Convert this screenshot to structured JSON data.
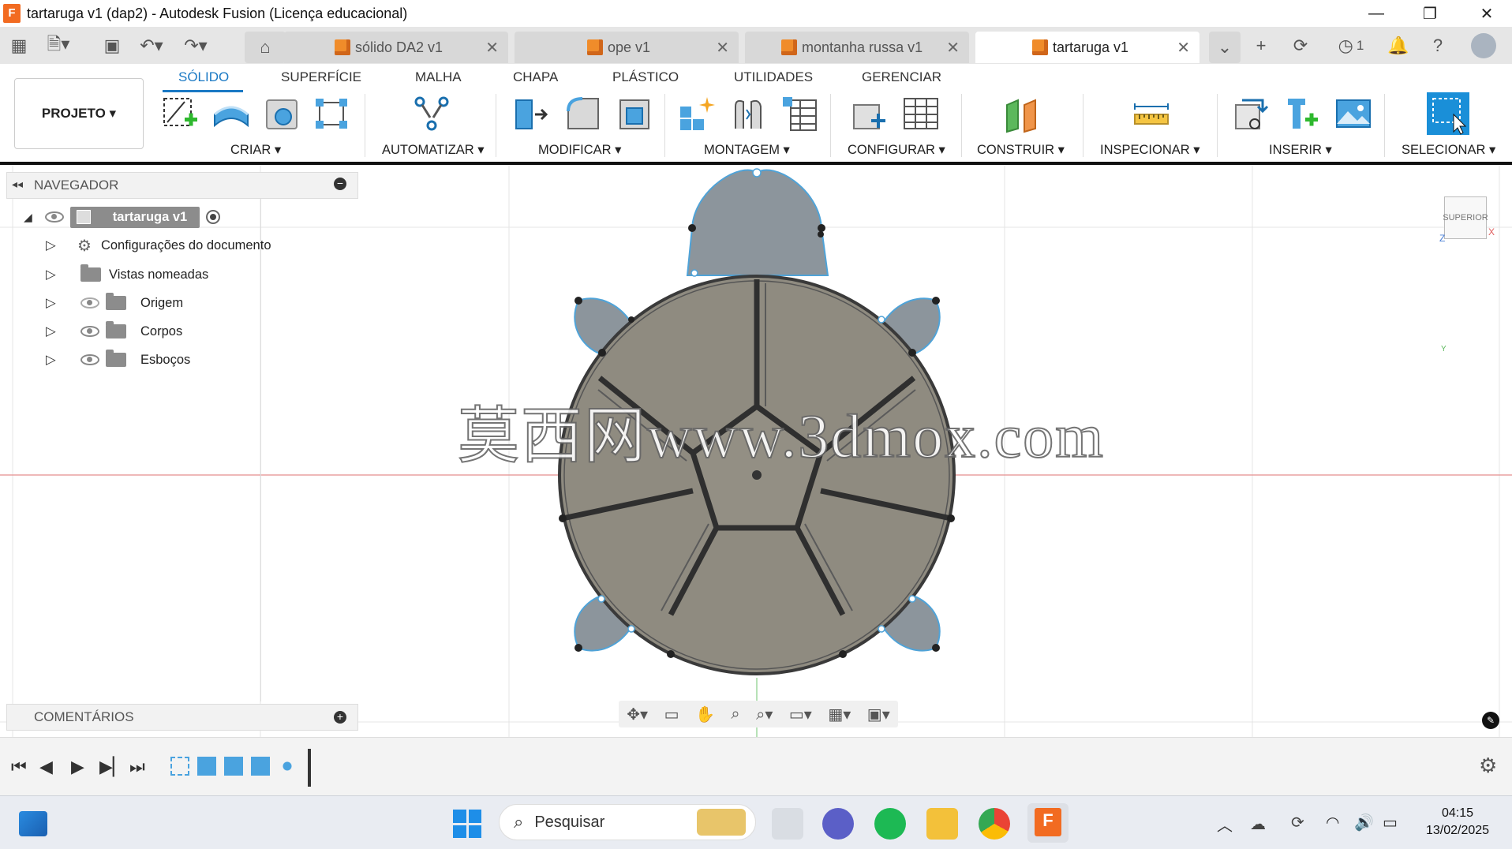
{
  "window": {
    "title": "tartaruga v1 (dap2) - Autodesk Fusion (Licença educacional)",
    "app_icon_letter": "F"
  },
  "tabs": [
    {
      "label": "sólido DA2 v1"
    },
    {
      "label": "ope v1"
    },
    {
      "label": "montanha russa v1"
    },
    {
      "label": "tartaruga v1"
    }
  ],
  "tabbar": {
    "clock_count": "1"
  },
  "ribbon": {
    "tabs": [
      "SÓLIDO",
      "SUPERFÍCIE",
      "MALHA",
      "CHAPA",
      "PLÁSTICO",
      "UTILIDADES",
      "GERENCIAR"
    ],
    "projeto": "PROJETO ▾",
    "groups": [
      "CRIAR ▾",
      "AUTOMATIZAR ▾",
      "MODIFICAR ▾",
      "MONTAGEM ▾",
      "CONFIGURAR ▾",
      "CONSTRUIR ▾",
      "INSPECIONAR ▾",
      "INSERIR ▾",
      "SELECIONAR ▾"
    ]
  },
  "navigator": {
    "title": "NAVEGADOR",
    "root": "tartaruga v1",
    "items": [
      "Configurações do documento",
      "Vistas nomeadas",
      "Origem",
      "Corpos",
      "Esboços"
    ]
  },
  "comments": {
    "title": "COMENTÁRIOS"
  },
  "viewcube": {
    "label": "SUPERIOR"
  },
  "watermark": "莫西网www.3dmox.com",
  "taskbar": {
    "search_placeholder": "Pesquisar",
    "time": "04:15",
    "date": "13/02/2025"
  },
  "colors": {
    "accent": "#1a79c4",
    "shell": "#8f8b80",
    "shell_stroke": "#3a3a3a",
    "limb": "#8c959c",
    "limb_stroke": "#4fa3d8"
  }
}
